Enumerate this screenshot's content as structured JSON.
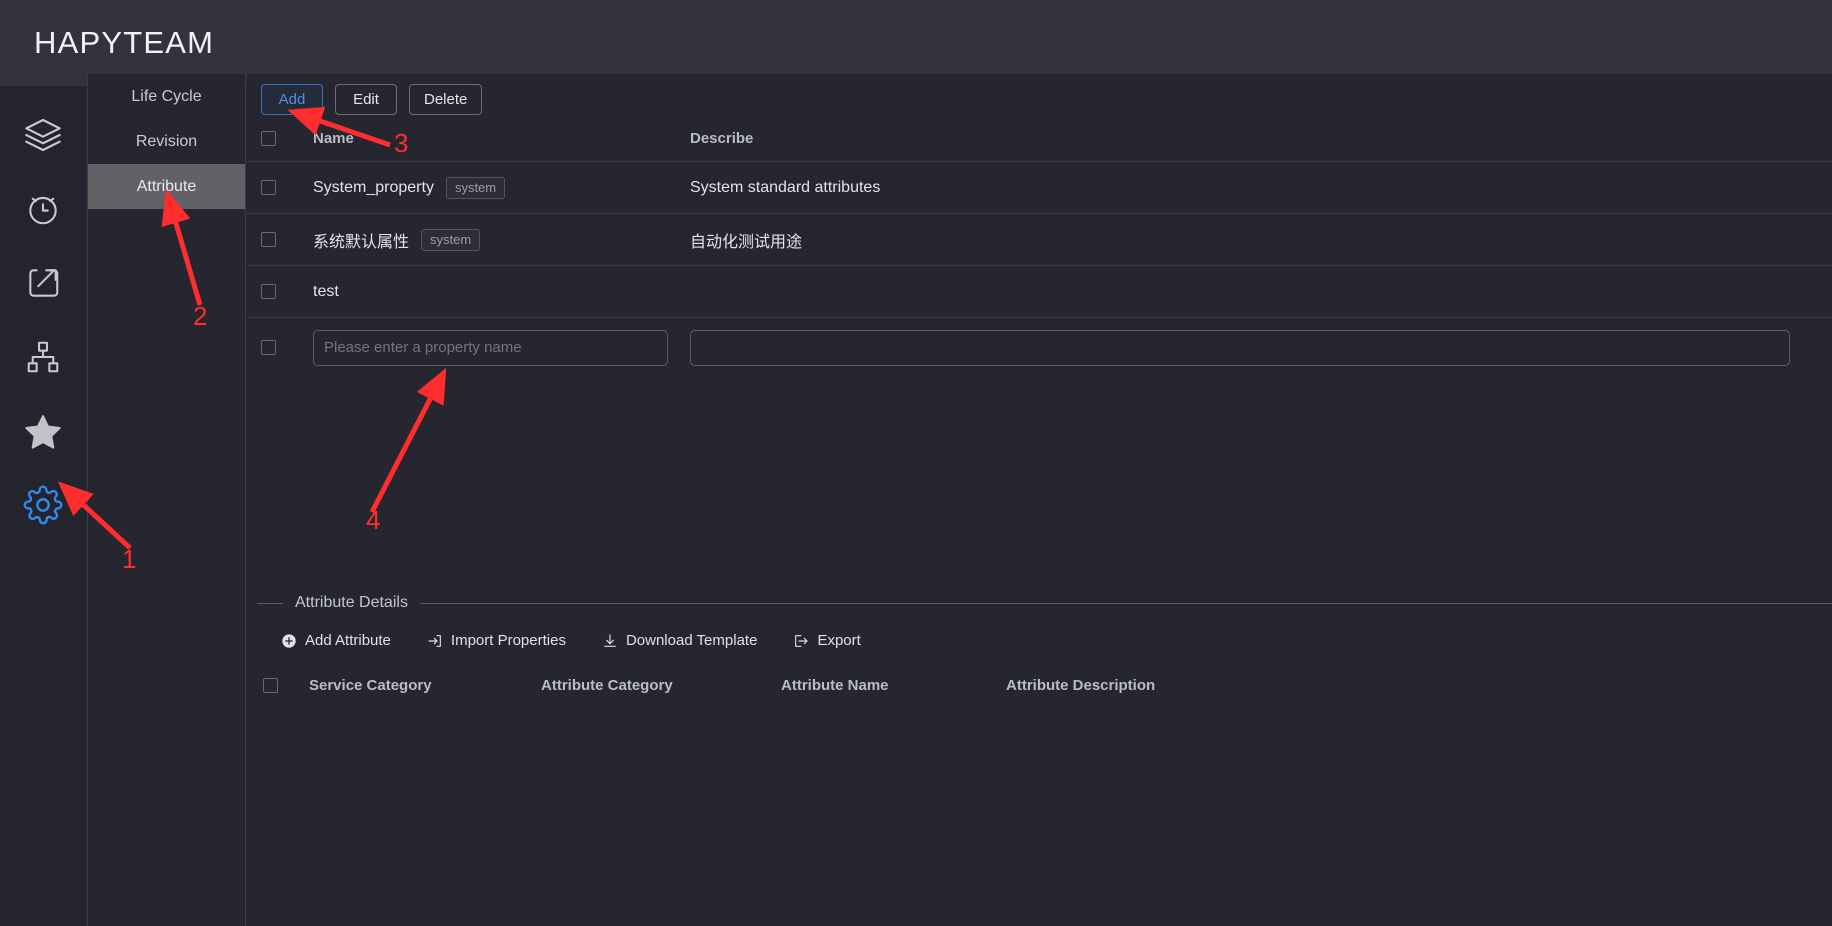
{
  "header": {
    "brand": "HAPYTEAM"
  },
  "icon_rail": {
    "items": [
      {
        "name": "layers-icon",
        "label": "Layers",
        "active": false
      },
      {
        "name": "clock-icon",
        "label": "History",
        "active": false
      },
      {
        "name": "share-icon",
        "label": "Share",
        "active": false
      },
      {
        "name": "sitemap-icon",
        "label": "Structure",
        "active": false
      },
      {
        "name": "star-icon",
        "label": "Favorites",
        "active": false
      },
      {
        "name": "gear-icon",
        "label": "Settings",
        "active": true
      }
    ],
    "active_color": "#2f8cf0",
    "inactive_color": "#c9c9cf"
  },
  "sub_nav": {
    "items": [
      {
        "label": "Life Cycle",
        "active": false
      },
      {
        "label": "Revision",
        "active": false
      },
      {
        "label": "Attribute",
        "active": true
      }
    ]
  },
  "toolbar": {
    "add_label": "Add",
    "edit_label": "Edit",
    "delete_label": "Delete"
  },
  "attribute_table": {
    "columns": [
      "Name",
      "Describe"
    ],
    "rows": [
      {
        "name": "System_property",
        "tag": "system",
        "describe": "System standard attributes"
      },
      {
        "name": "系统默认属性",
        "tag": "system",
        "describe": "自动化测试用途"
      },
      {
        "name": "test",
        "tag": "",
        "describe": ""
      }
    ],
    "new_row": {
      "name_placeholder": "Please enter a property name",
      "name_value": "",
      "describe_placeholder": "",
      "describe_value": ""
    }
  },
  "details": {
    "legend": "Attribute Details",
    "actions": [
      {
        "label": "Add Attribute",
        "icon": "plus-circle-icon"
      },
      {
        "label": "Import Properties",
        "icon": "import-icon"
      },
      {
        "label": "Download Template",
        "icon": "download-icon"
      },
      {
        "label": "Export",
        "icon": "export-icon"
      }
    ],
    "columns": [
      "Service Category",
      "Attribute Category",
      "Attribute Name",
      "Attribute Description"
    ],
    "rows": []
  },
  "annotations": {
    "accent_color": "#ff2d2d",
    "markers": [
      {
        "number": "1",
        "target": "gear-icon"
      },
      {
        "number": "2",
        "target": "sidebar-item-attribute"
      },
      {
        "number": "3",
        "target": "add-button"
      },
      {
        "number": "4",
        "target": "property-name-input"
      }
    ]
  }
}
